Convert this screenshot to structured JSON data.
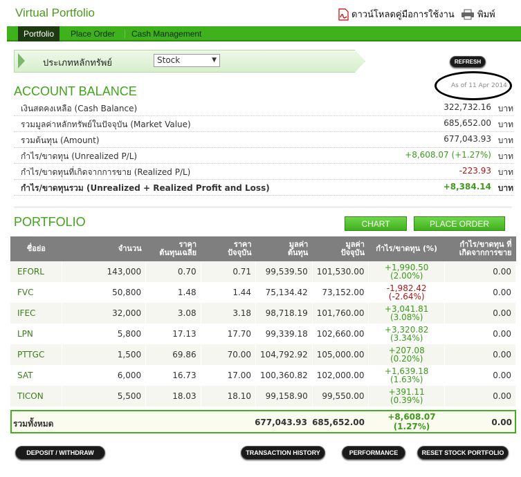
{
  "header": {
    "title": "Virtual Portfolio",
    "manual_label": "ดาวน์โหลดคู่มือการใช้งาน",
    "print_label": "พิมพ์"
  },
  "nav": {
    "tabs": [
      {
        "label": "Portfolio"
      },
      {
        "label": "Place Order"
      },
      {
        "label": "Cash Management"
      }
    ]
  },
  "filter": {
    "label": "ประเภทหลักทรัพย์",
    "selected": "Stock"
  },
  "refresh_label": "REFRESH",
  "as_of": "As of 11 Apr 2014",
  "account": {
    "title": "ACCOUNT BALANCE",
    "rows": [
      {
        "label": "เงินสดคงเหลือ (Cash Balance)",
        "value": "322,732.16",
        "unit": "บาท"
      },
      {
        "label": "รวมมูลค่าหลักทรัพย์ในปัจจุบัน (Market Value)",
        "value": "685,652.00",
        "unit": "บาท"
      },
      {
        "label": "รวมต้นทุน (Amount)",
        "value": "677,043.93",
        "unit": "บาท"
      },
      {
        "label": "กำไร/ขาดทุน (Unrealized P/L)",
        "value": "+8,608.07 (+1.27%)",
        "unit": "บาท"
      },
      {
        "label": "กำไร/ขาดทุนที่เกิดจากการขาย (Realized P/L)",
        "value": "-223.93",
        "unit": "บาท"
      },
      {
        "label": "กำไร/ขาดทุนรวม (Unrealized + Realized Profit and Loss)",
        "value": "+8,384.14",
        "unit": "บาท"
      }
    ]
  },
  "portfolio": {
    "title": "PORTFOLIO",
    "chart_label": "CHART",
    "place_order_label": "PLACE ORDER",
    "columns": {
      "symbol": "ชื่อย่อ",
      "volume": "จำนวน",
      "avg_cost_1": "ราคา",
      "avg_cost_2": "ต้นทุนเฉลี่ย",
      "price_1": "ราคา",
      "price_2": "ปัจจุบัน",
      "amount_1": "มูลค่า",
      "amount_2": "ต้นทุน",
      "mv_1": "มูลค่า",
      "mv_2": "ปัจจุบัน",
      "upl": "กำไร/ขาดทุน (%)",
      "rpl_1": "กำไร/ขาดทุน ที่",
      "rpl_2": "เกิดจากการขาย"
    },
    "rows": [
      {
        "symbol": "EFORL",
        "volume": "143,000",
        "avg_cost": "0.70",
        "price": "0.71",
        "amount": "99,539.50",
        "market_value": "101,530.00",
        "pl": "+1,990.50",
        "pl_pct": "(2.00%)",
        "realized": "0.00"
      },
      {
        "symbol": "FVC",
        "volume": "50,800",
        "avg_cost": "1.48",
        "price": "1.44",
        "amount": "75,134.42",
        "market_value": "73,152.00",
        "pl": "-1,982.42",
        "pl_pct": "(-2.64%)",
        "realized": "0.00"
      },
      {
        "symbol": "IFEC",
        "volume": "32,000",
        "avg_cost": "3.08",
        "price": "3.18",
        "amount": "98,718.19",
        "market_value": "101,760.00",
        "pl": "+3,041.81",
        "pl_pct": "(3.08%)",
        "realized": "0.00"
      },
      {
        "symbol": "LPN",
        "volume": "5,800",
        "avg_cost": "17.13",
        "price": "17.70",
        "amount": "99,339.18",
        "market_value": "102,660.00",
        "pl": "+3,320.82",
        "pl_pct": "(3.34%)",
        "realized": "0.00"
      },
      {
        "symbol": "PTTGC",
        "volume": "1,500",
        "avg_cost": "69.86",
        "price": "70.00",
        "amount": "104,792.92",
        "market_value": "105,000.00",
        "pl": "+207.08",
        "pl_pct": "(0.20%)",
        "realized": "0.00"
      },
      {
        "symbol": "SAT",
        "volume": "6,000",
        "avg_cost": "16.73",
        "price": "17.00",
        "amount": "100,360.82",
        "market_value": "102,000.00",
        "pl": "+1,639.18",
        "pl_pct": "(1.63%)",
        "realized": "0.00"
      },
      {
        "symbol": "TICON",
        "volume": "5,500",
        "avg_cost": "18.03",
        "price": "18.10",
        "amount": "99,158.90",
        "market_value": "99,550.00",
        "pl": "+391.11",
        "pl_pct": "(0.39%)",
        "realized": "0.00"
      }
    ],
    "totals": {
      "label": "รวมทั้งหมด",
      "amount": "677,043.93",
      "market_value": "685,652.00",
      "pl": "+8,608.07",
      "pl_pct": "(1.27%)",
      "realized": "0.00"
    }
  },
  "footer_buttons": {
    "deposit": "DEPOSIT / WITHDRAW",
    "history": "TRANSACTION HISTORY",
    "performance": "PERFORMANCE",
    "reset": "RESET STOCK PORTFOLIO"
  },
  "colors": {
    "accent_green": "#3fb11c",
    "positive": "#3b9b1a",
    "negative": "#b01515",
    "header_gray": "#7f7f7f"
  }
}
